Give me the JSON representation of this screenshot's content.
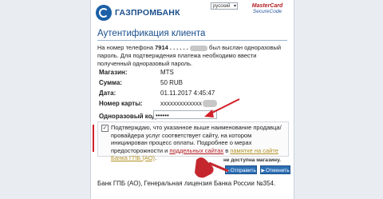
{
  "header": {
    "bank_name": "ГАЗПРОМБАНК",
    "language": "русский",
    "mastercard_top": "MasterCard",
    "mastercard_bottom": "SecureCode"
  },
  "title": "Аутентификация клиента",
  "info": {
    "prefix": "На номер телефона",
    "phone": "7914 . . . . . .",
    "suffix": "был выслан одноразовый пароль. Для подтверждения платежа необходимо ввести полученный одноразовый пароль."
  },
  "details": [
    {
      "label": "Магазин:",
      "value": "MTS"
    },
    {
      "label": "Сумма:",
      "value": "50 RUB"
    },
    {
      "label": "Дата:",
      "value": "01.11.2017 4:45:47"
    },
    {
      "label": "Номер карты:",
      "value": "xxxxxxxxxxxxx"
    }
  ],
  "otp": {
    "label": "Одноразовый код:",
    "value": "••••••"
  },
  "consent": {
    "text_main": "Подтверждаю, что указанное выше наименование продавца/провайдера услуг соответствует сайту, на котором инициирован процесс оплаты. Подробнее о мерах предосторожности и ",
    "link1": "поддельных сайтах",
    "middle": " в ",
    "link2": "памятке на сайте Банка ГПБ (АО)",
    "end": "."
  },
  "not_available": "не доступна магазину.",
  "buttons": {
    "send": "Отправить",
    "cancel": "Отменить"
  },
  "footer": "Банк ГПБ (АО), Генеральная лицензия Банка России №354.",
  "colors": {
    "brand": "#1b4f8d",
    "button": "#2d6fb5",
    "highlight": "#d1202a"
  }
}
